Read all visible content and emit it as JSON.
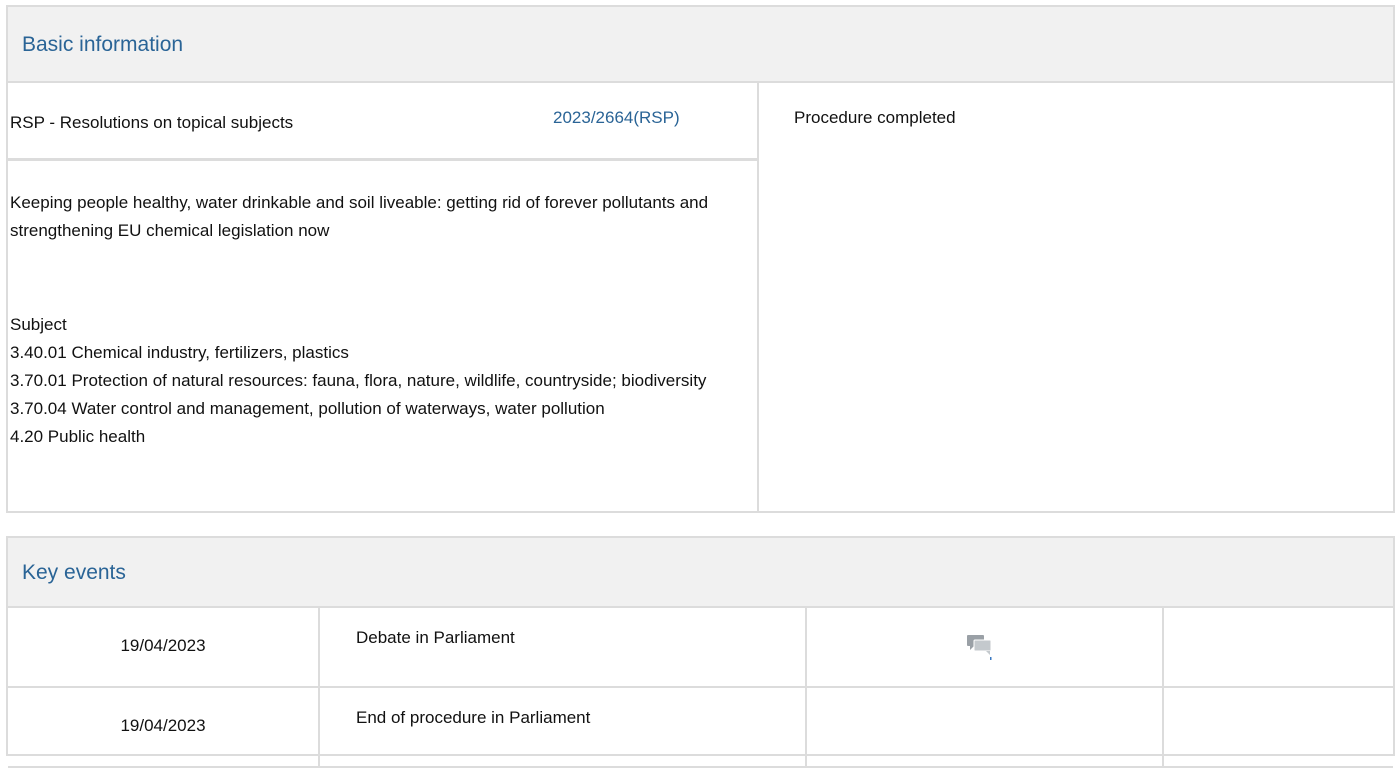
{
  "basic_information": {
    "header": "Basic information",
    "procedure_type": "RSP - Resolutions on topical subjects",
    "reference": "2023/2664(RSP)",
    "status": "Procedure completed",
    "title": "Keeping people healthy, water drinkable and soil liveable: getting rid of forever pollutants and strengthening EU chemical legislation now",
    "subject_label": "Subject",
    "subjects": [
      "3.40.01 Chemical industry, fertilizers, plastics",
      "3.70.01 Protection of natural resources: fauna, flora, nature, wildlife, countryside; biodiversity",
      "3.70.04 Water control and management, pollution of waterways, water pollution",
      "4.20 Public health"
    ]
  },
  "key_events": {
    "header": "Key events",
    "rows": [
      {
        "date": "19/04/2023",
        "event": "Debate in Parliament",
        "icon": "debate-icon"
      },
      {
        "date": "19/04/2023",
        "event": "End of procedure in Parliament",
        "icon": ""
      }
    ]
  },
  "colors": {
    "link": "#2a6496",
    "border": "#dcdcdc",
    "header_bg": "#f1f1f1"
  }
}
